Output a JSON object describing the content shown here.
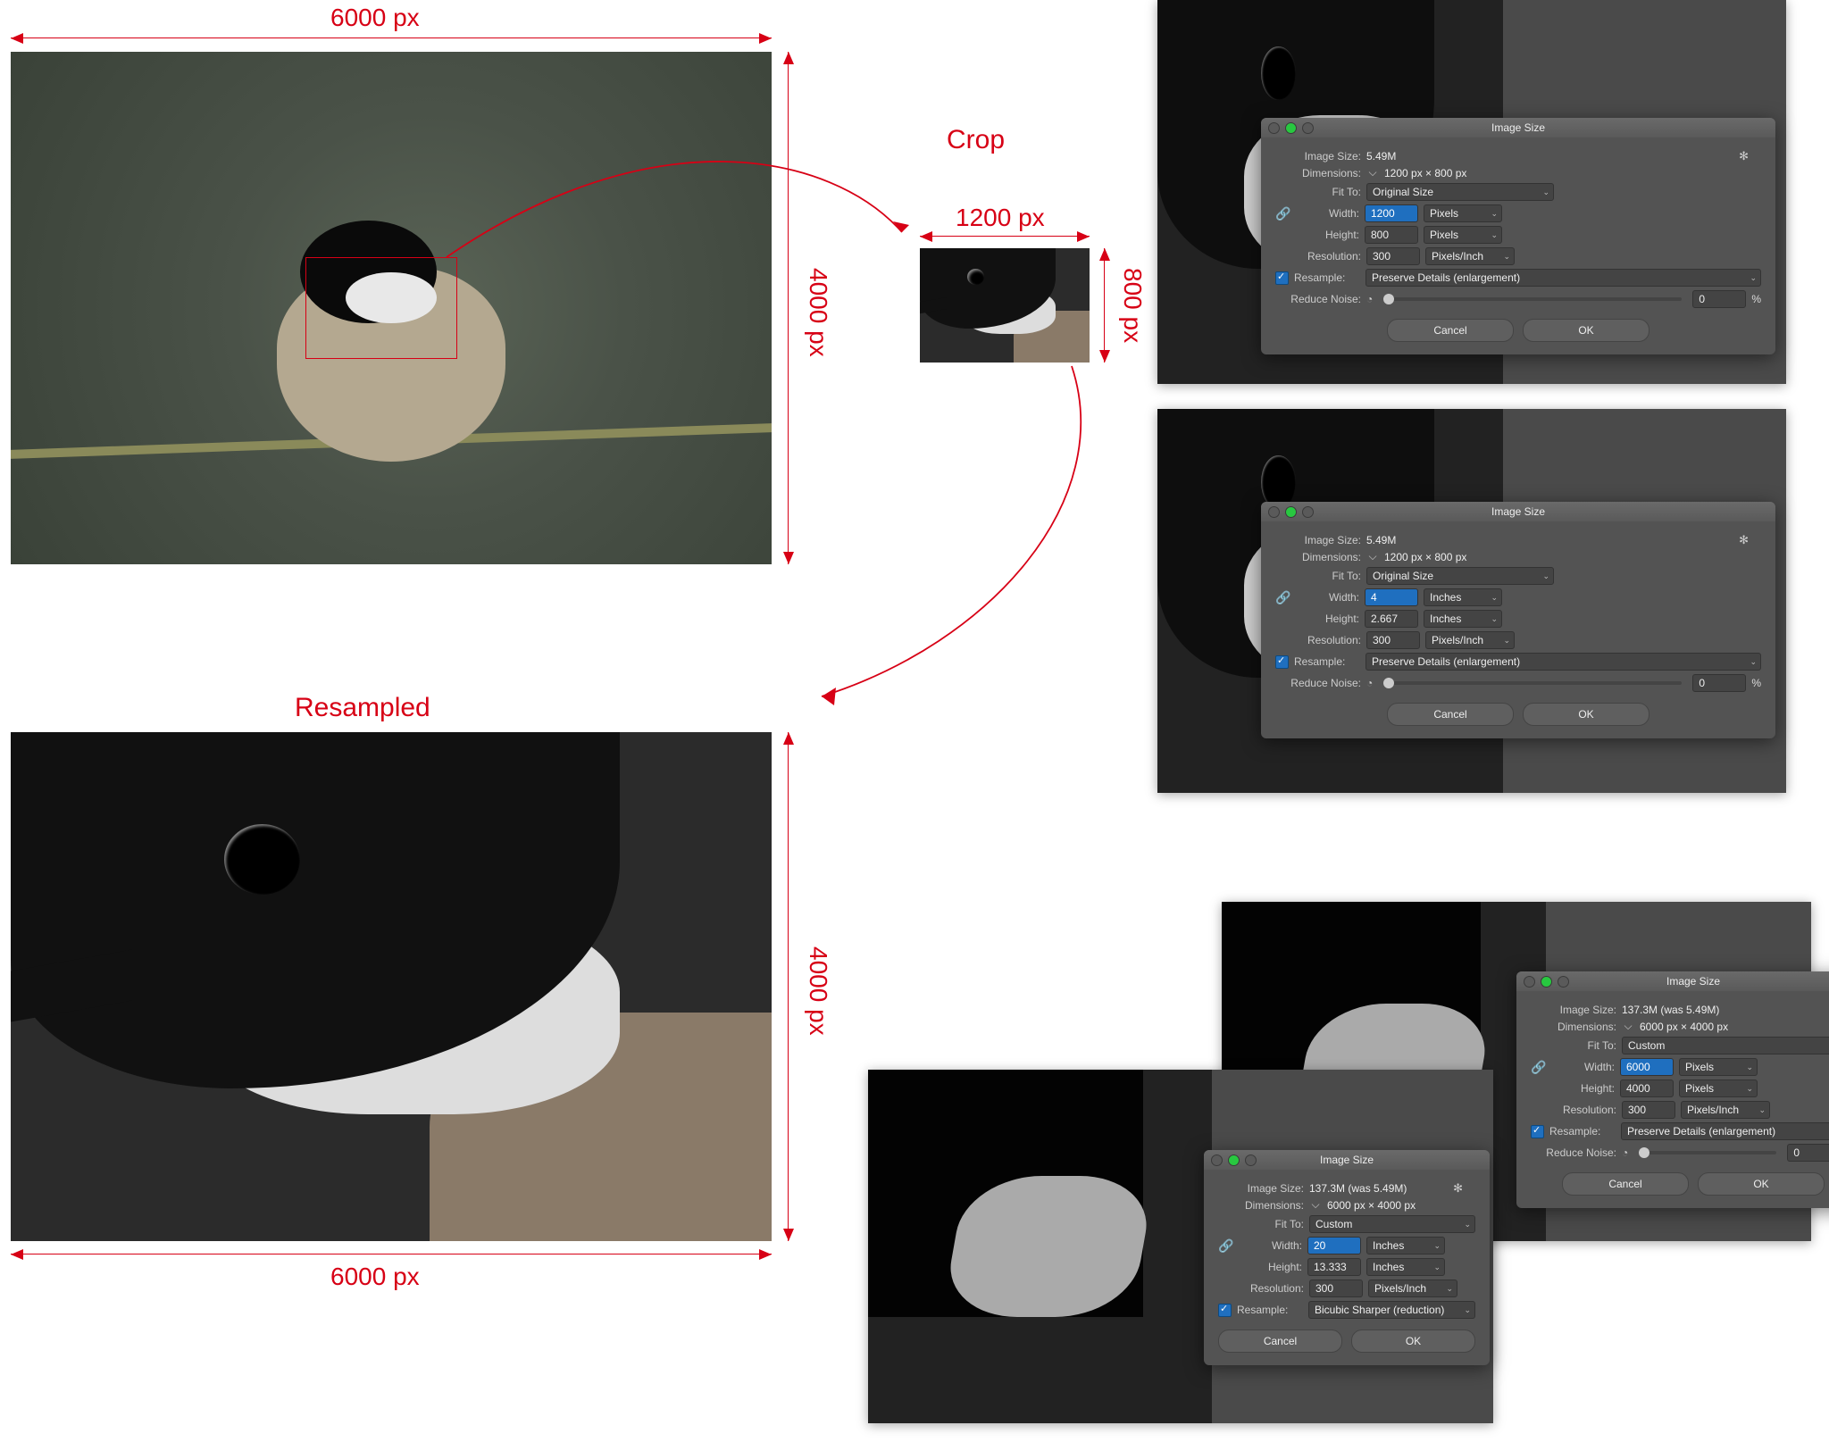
{
  "labels": {
    "title_crop": "Crop",
    "title_resampled": "Resampled",
    "orig_w": "6000 px",
    "orig_h": "4000 px",
    "crop_w": "1200 px",
    "crop_h": "800 px",
    "resamp_w": "6000 px",
    "resamp_h": "4000 px"
  },
  "dialog_common": {
    "window_title": "Image Size",
    "image_size_label": "Image Size:",
    "dimensions_label": "Dimensions:",
    "fit_to_label": "Fit To:",
    "width_label": "Width:",
    "height_label": "Height:",
    "resolution_label": "Resolution:",
    "resample_label": "Resample:",
    "reduce_noise_label": "Reduce Noise:",
    "cancel": "Cancel",
    "ok": "OK",
    "pct": "%"
  },
  "dialogs": [
    {
      "image_size": "5.49M",
      "dimensions": "1200 px × 800 px",
      "fit_to": "Original Size",
      "width": "1200",
      "width_unit": "Pixels",
      "width_selected": true,
      "height": "800",
      "height_unit": "Pixels",
      "resolution": "300",
      "resolution_unit": "Pixels/Inch",
      "resample": "Preserve Details (enlargement)",
      "reduce_noise": "0"
    },
    {
      "image_size": "5.49M",
      "dimensions": "1200 px × 800 px",
      "fit_to": "Original Size",
      "width": "4",
      "width_unit": "Inches",
      "width_selected": true,
      "height": "2.667",
      "height_unit": "Inches",
      "resolution": "300",
      "resolution_unit": "Pixels/Inch",
      "resample": "Preserve Details (enlargement)",
      "reduce_noise": "0"
    },
    {
      "image_size": "137.3M (was 5.49M)",
      "dimensions": "6000 px × 4000 px",
      "fit_to": "Custom",
      "width": "6000",
      "width_unit": "Pixels",
      "width_selected": true,
      "height": "4000",
      "height_unit": "Pixels",
      "resolution": "300",
      "resolution_unit": "Pixels/Inch",
      "resample": "Preserve Details (enlargement)",
      "reduce_noise": "0"
    },
    {
      "image_size": "137.3M (was 5.49M)",
      "dimensions": "6000 px × 4000 px",
      "fit_to": "Custom",
      "width": "20",
      "width_unit": "Inches",
      "width_selected": true,
      "height": "13.333",
      "height_unit": "Inches",
      "resolution": "300",
      "resolution_unit": "Pixels/Inch",
      "resample": "Bicubic Sharper (reduction)",
      "reduce_noise": null
    }
  ]
}
